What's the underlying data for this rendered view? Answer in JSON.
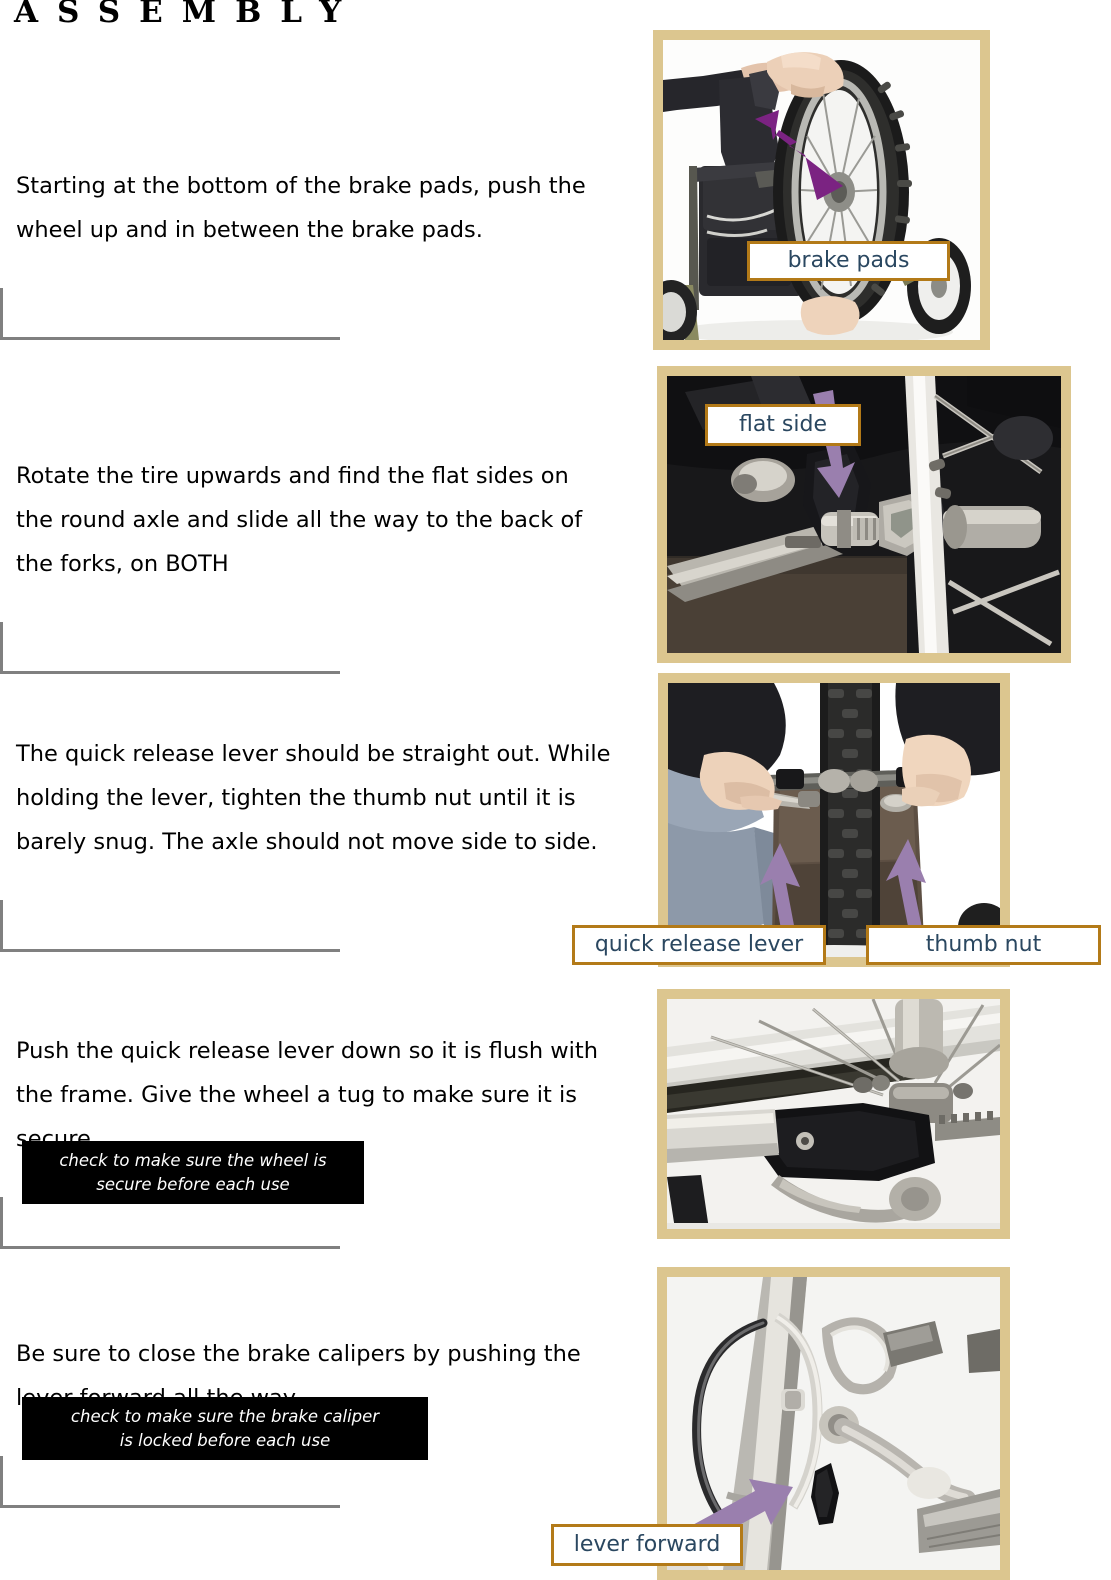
{
  "document": {
    "title": "ASSEMBLY"
  },
  "steps": [
    {
      "id": "step1",
      "text": "Starting at the bottom of the brake pads, push the wheel up and in between the brake pads."
    },
    {
      "id": "step2",
      "text": "Rotate the tire upwards and find the flat sides on the round axle and slide all the way to the back of the forks, on BOTH"
    },
    {
      "id": "step3",
      "text": "The quick release lever should be straight out.  While holding the lever, tighten the thumb nut until it is barely snug.  The axle should not move side to side."
    },
    {
      "id": "step4",
      "text": "Push the quick release lever down so it is flush with the frame.  Give the wheel a tug to make sure it is secure."
    },
    {
      "id": "step5",
      "text": "Be sure to close the brake calipers by pushing the lever forward all the way."
    }
  ],
  "cautions": [
    {
      "id": "caution1",
      "text": "check to make sure the wheel is\nsecure before each use"
    },
    {
      "id": "caution2",
      "text": "check to make sure the brake caliper\nis locked before each use"
    }
  ],
  "photos": [
    {
      "id": "photo1",
      "alt": "Hands pushing a wheelchair wheel up between the brake pads"
    },
    {
      "id": "photo2",
      "alt": "Close-up of the round axle with flat sides and the axle nut"
    },
    {
      "id": "photo3",
      "alt": "Two hands holding the quick release lever and the thumb nut on either side of the tire"
    },
    {
      "id": "photo4",
      "alt": "Quick release lever pushed down flush with the frame"
    },
    {
      "id": "photo5",
      "alt": "Brake caliper with the lever pushed forward and locked"
    }
  ],
  "callouts": [
    {
      "id": "callout-brake-pads",
      "label": "brake pads"
    },
    {
      "id": "callout-flat-side",
      "label": "flat side"
    },
    {
      "id": "callout-qr-lever",
      "label": "quick release lever"
    },
    {
      "id": "callout-thumb-nut",
      "label": "thumb nut"
    },
    {
      "id": "callout-lever-forward",
      "label": "lever forward"
    }
  ],
  "colors": {
    "photo_frame": "#dcc68f",
    "callout_border": "#b37a18",
    "callout_text": "#2a4760",
    "arrow_dark": "#7b2382",
    "arrow_light": "#9a7fae",
    "rule": "#808080",
    "caution_bg": "#000000",
    "caution_text": "#ffffff"
  }
}
